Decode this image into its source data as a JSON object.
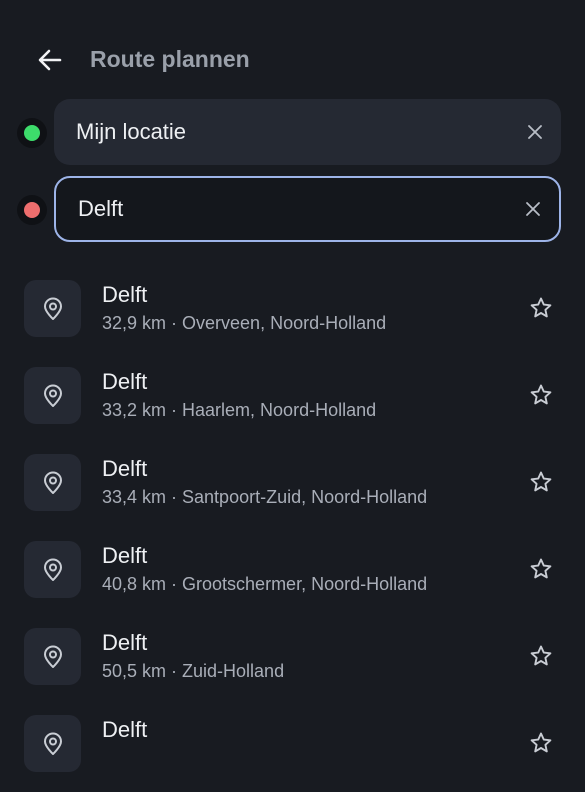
{
  "header": {
    "title": "Route plannen"
  },
  "origin": {
    "value": "Mijn locatie",
    "dot_color": "#3ddc6b"
  },
  "destination": {
    "value": "Delft",
    "dot_color": "#ee6e6e"
  },
  "results": [
    {
      "name": "Delft",
      "distance": "32,9 km",
      "place": "Overveen, Noord-Holland"
    },
    {
      "name": "Delft",
      "distance": "33,2 km",
      "place": "Haarlem, Noord-Holland"
    },
    {
      "name": "Delft",
      "distance": "33,4 km",
      "place": "Santpoort-Zuid, Noord-Holland"
    },
    {
      "name": "Delft",
      "distance": "40,8 km",
      "place": "Grootschermer, Noord-Holland"
    },
    {
      "name": "Delft",
      "distance": "50,5 km",
      "place": "Zuid-Holland"
    },
    {
      "name": "Delft",
      "distance": "",
      "place": ""
    }
  ],
  "icons": {
    "back": "arrow-left-icon",
    "clear": "close-icon",
    "pin": "map-pin-icon",
    "favorite": "star-outline-icon"
  }
}
